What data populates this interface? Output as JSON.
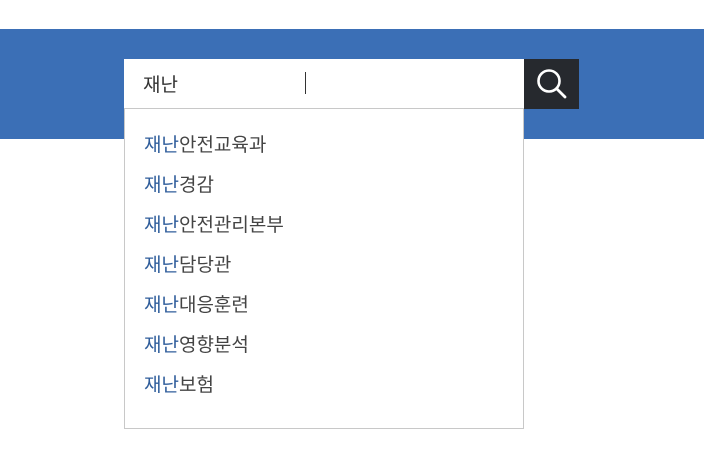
{
  "search": {
    "value": "재난",
    "button_icon": "search-icon"
  },
  "colors": {
    "banner": "#3b6fb6",
    "button": "#26292e",
    "match_highlight": "#2f5d9b",
    "text": "#444444"
  },
  "suggestions": [
    {
      "match": "재난",
      "rest": "안전교육과"
    },
    {
      "match": "재난",
      "rest": "경감"
    },
    {
      "match": "재난",
      "rest": "안전관리본부"
    },
    {
      "match": "재난",
      "rest": "담당관"
    },
    {
      "match": "재난",
      "rest": "대응훈련"
    },
    {
      "match": "재난",
      "rest": "영향분석"
    },
    {
      "match": "재난",
      "rest": "보험"
    }
  ]
}
